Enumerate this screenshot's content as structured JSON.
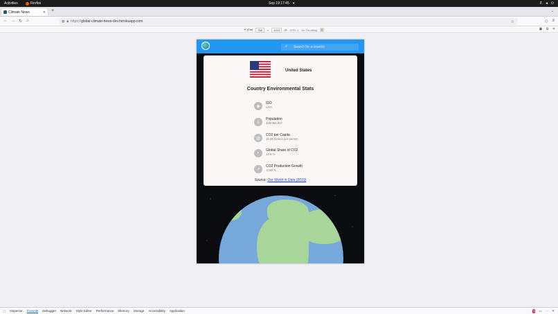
{
  "system": {
    "activities": "Activities",
    "app_name": "Firefox",
    "clock": "Sep 19  17:45"
  },
  "browser": {
    "tab_title": "Climate News",
    "url_protocol": "https://",
    "url_host": "global-climate-news-dev.herokuapp.com"
  },
  "rdm": {
    "device": "iPad",
    "width": "768",
    "height": "1024",
    "dpr": "DPR: 1",
    "throttling": "No Throttling"
  },
  "page": {
    "search_placeholder": "Search for a country",
    "country_name": "United States",
    "stats_title": "Country Environmental Stats",
    "stats": [
      {
        "label": "ISO",
        "value": "USA",
        "icon": "fingerprint-icon"
      },
      {
        "label": "Population",
        "value": "329,064,917",
        "icon": "person-icon"
      },
      {
        "label": "CO2 per Capita",
        "value": "16.06 tonnes per person",
        "icon": "factory-icon"
      },
      {
        "label": "Global Share of CO2",
        "value": "14.5 %",
        "icon": "globe-icon"
      },
      {
        "label": "CO2 Production Growth",
        "value": "-2.58 %",
        "icon": "trending-icon"
      }
    ],
    "source_label": "Source:",
    "source_link": "Our World in Data (2019)"
  },
  "devtools": {
    "tabs": [
      "Inspector",
      "Console",
      "Debugger",
      "Network",
      "Style Editor",
      "Performance",
      "Memory",
      "Storage",
      "Accessibility",
      "Application"
    ],
    "active_tab": "Console",
    "error_count": "1"
  }
}
